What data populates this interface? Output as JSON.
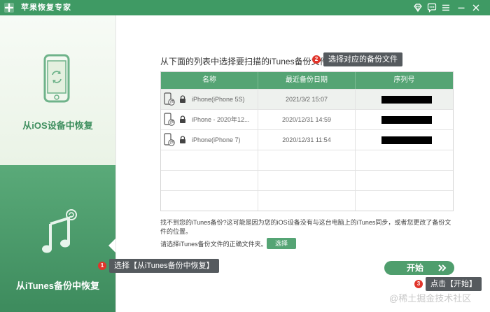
{
  "window": {
    "title": "苹果恢复专家",
    "theme_color": "#3f9a64"
  },
  "titlebar_icons": [
    "diamond-icon",
    "chat-icon",
    "menu-icon",
    "minimize-icon",
    "close-icon"
  ],
  "sidebar": {
    "items": [
      {
        "label": "从iOS设备中恢复",
        "icon": "phone-restore-icon"
      },
      {
        "label": "从iTunes备份中恢复",
        "icon": "music-restore-icon",
        "active": true
      }
    ]
  },
  "main": {
    "instruction": "从下面的列表中选择要扫描的iTunes备份文件。",
    "table": {
      "headers": [
        "名称",
        "最近备份日期",
        "序列号"
      ],
      "rows": [
        {
          "name": "iPhone(iPhone 5S)",
          "date": "2021/3/2 15:07",
          "selected": true
        },
        {
          "name": "iPhone - 2020年12...",
          "date": "2020/12/31 14:59"
        },
        {
          "name": "iPhone(iPhone 7)",
          "date": "2020/12/31 11:54"
        }
      ],
      "empty_rows": 3
    },
    "hint": "找不到您的iTunes备份?这可能是因为您的iOS设备没有与这台电脑上的iTunes同步，或者您更改了备份文件的位置。",
    "folder_label": "请选择iTunes备份文件的正确文件夹。",
    "select_button": "选择",
    "start_button": "开始"
  },
  "tooltips": [
    {
      "badge": "1",
      "text": "选择【从iTunes备份中恢复】"
    },
    {
      "badge": "2",
      "text": "选择对应的备份文件"
    },
    {
      "badge": "3",
      "text": "点击【开始】"
    }
  ],
  "watermark": "@稀土掘金技术社区"
}
